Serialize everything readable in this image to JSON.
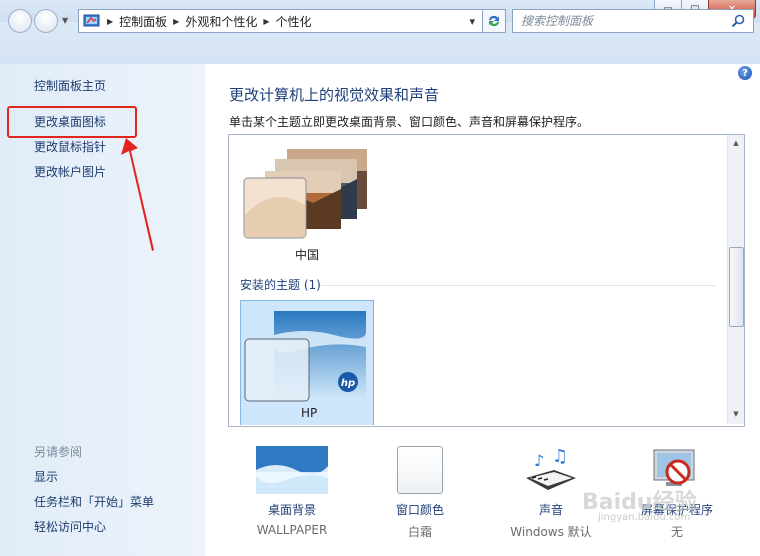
{
  "window_buttons": {
    "minimize": "▭",
    "maximize": "□",
    "close": "✕"
  },
  "address": {
    "crumbs": [
      "控制面板",
      "外观和个性化",
      "个性化"
    ],
    "dropdown_arrow": "▾"
  },
  "search": {
    "placeholder": "搜索控制面板"
  },
  "sidebar": {
    "home": "控制面板主页",
    "links": [
      "更改桌面图标",
      "更改鼠标指针",
      "更改帐户图片"
    ],
    "see_also_title": "另请参阅",
    "see_also": [
      "显示",
      "任务栏和「开始」菜单",
      "轻松访问中心"
    ]
  },
  "main": {
    "title": "更改计算机上的视觉效果和声音",
    "description": "单击某个主题立即更改桌面背景、窗口颜色、声音和屏幕保护程序。",
    "help": "?"
  },
  "themes": {
    "china_label": "中国",
    "installed_heading": "安装的主题 (1)",
    "hp_label": "HP",
    "hp_logo": "hp"
  },
  "bottom": {
    "wallpaper": {
      "label": "桌面背景",
      "value": "WALLPAPER"
    },
    "color": {
      "label": "窗口颜色",
      "value": "白霜"
    },
    "sound": {
      "label": "声音",
      "value": "Windows 默认"
    },
    "screensaver": {
      "label": "屏幕保护程序",
      "value": "无"
    }
  },
  "watermark": {
    "brand": "Baidu经验",
    "url": "jingyan.baidu.com"
  },
  "colors": {
    "accent_link": "#1e3d6e",
    "highlight_red": "#e0261f",
    "selected_theme": "#cde6fb"
  }
}
